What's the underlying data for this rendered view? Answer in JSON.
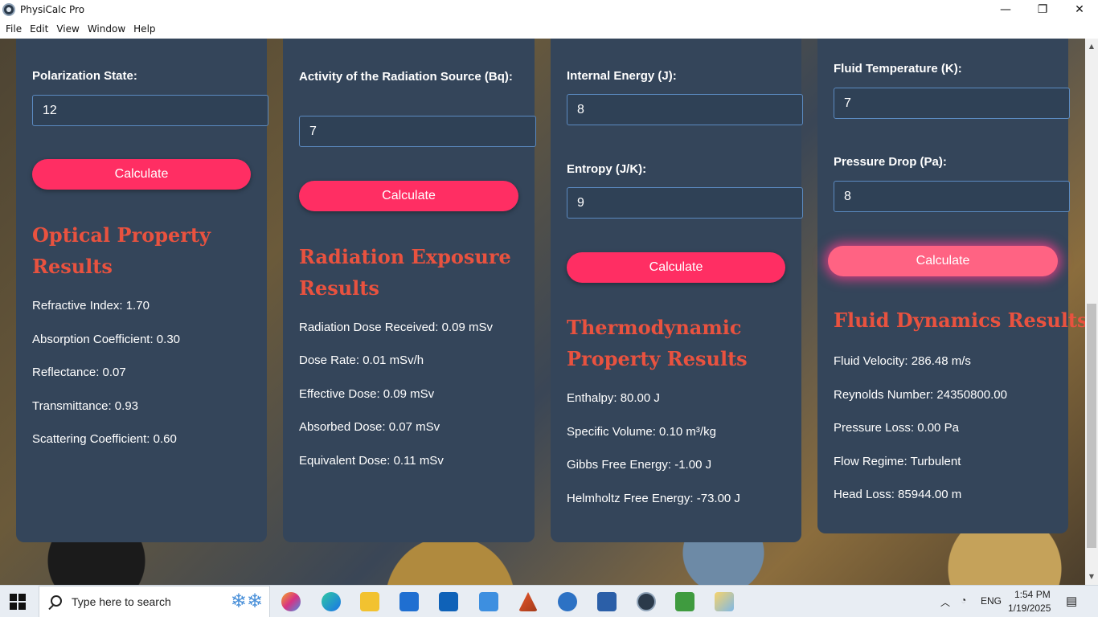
{
  "window": {
    "title": "PhysiCalc Pro",
    "controls": {
      "minimize": "—",
      "maximize": "❐",
      "close": "✕"
    }
  },
  "menu": [
    "File",
    "Edit",
    "View",
    "Window",
    "Help"
  ],
  "cards": [
    {
      "fields": [
        {
          "label": "Polarization State:",
          "value": "12"
        }
      ],
      "button": "Calculate",
      "results_title": "Optical Property Results",
      "results": [
        "Refractive Index: 1.70",
        "Absorption Coefficient: 0.30",
        "Reflectance: 0.07",
        "Transmittance: 0.93",
        "Scattering Coefficient: 0.60"
      ]
    },
    {
      "fields": [
        {
          "label": "Activity of the Radiation Source (Bq):",
          "value": "7"
        }
      ],
      "button": "Calculate",
      "results_title": "Radiation Exposure Results",
      "results": [
        "Radiation Dose Received: 0.09 mSv",
        "Dose Rate: 0.01 mSv/h",
        "Effective Dose: 0.09 mSv",
        "Absorbed Dose: 0.07 mSv",
        "Equivalent Dose: 0.11 mSv"
      ]
    },
    {
      "fields": [
        {
          "label": "Internal Energy (J):",
          "value": "8"
        },
        {
          "label": "Entropy (J/K):",
          "value": "9"
        }
      ],
      "button": "Calculate",
      "results_title": "Thermodynamic Property Results",
      "results": [
        "Enthalpy: 80.00 J",
        "Specific Volume: 0.10 m³/kg",
        "Gibbs Free Energy: -1.00 J",
        "Helmholtz Free Energy: -73.00 J"
      ]
    },
    {
      "fields": [
        {
          "label": "Fluid Temperature (K):",
          "value": "7"
        },
        {
          "label": "Pressure Drop (Pa):",
          "value": "8"
        }
      ],
      "button": "Calculate",
      "results_title": "Fluid Dynamics Results",
      "results": [
        "Fluid Velocity: 286.48 m/s",
        "Reynolds Number: 24350800.00",
        "Pressure Loss: 0.00 Pa",
        "Flow Regime: Turbulent",
        "Head Loss: 85944.00 m"
      ]
    }
  ],
  "taskbar": {
    "search_placeholder": "Type here to search",
    "language": "ENG",
    "time": "1:54 PM",
    "date": "1/19/2025"
  }
}
